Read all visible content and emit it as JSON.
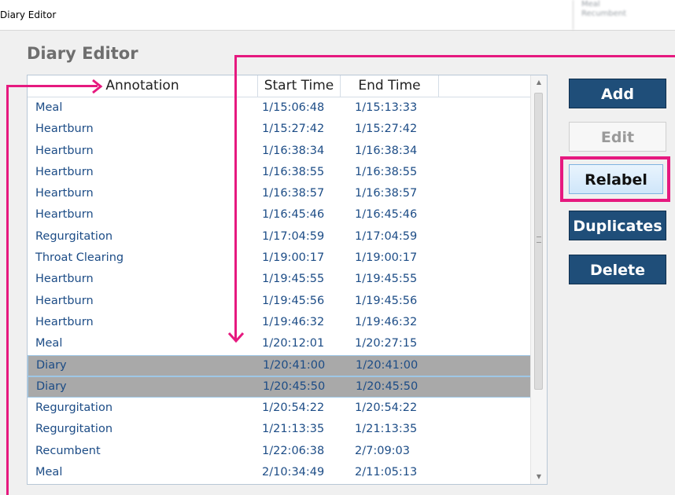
{
  "window": {
    "title": "Diary Editor",
    "blurred_text": [
      "Meal",
      "Recumbent"
    ]
  },
  "heading": "Diary Editor",
  "table": {
    "columns": [
      "Annotation",
      "Start Time",
      "End Time"
    ],
    "rows": [
      {
        "annotation": "Meal",
        "start": "1/15:06:48",
        "end": "1/15:13:33",
        "selected": false
      },
      {
        "annotation": "Heartburn",
        "start": "1/15:27:42",
        "end": "1/15:27:42",
        "selected": false
      },
      {
        "annotation": "Heartburn",
        "start": "1/16:38:34",
        "end": "1/16:38:34",
        "selected": false
      },
      {
        "annotation": "Heartburn",
        "start": "1/16:38:55",
        "end": "1/16:38:55",
        "selected": false
      },
      {
        "annotation": "Heartburn",
        "start": "1/16:38:57",
        "end": "1/16:38:57",
        "selected": false
      },
      {
        "annotation": "Heartburn",
        "start": "1/16:45:46",
        "end": "1/16:45:46",
        "selected": false
      },
      {
        "annotation": "Regurgitation",
        "start": "1/17:04:59",
        "end": "1/17:04:59",
        "selected": false
      },
      {
        "annotation": "Throat Clearing",
        "start": "1/19:00:17",
        "end": "1/19:00:17",
        "selected": false
      },
      {
        "annotation": "Heartburn",
        "start": "1/19:45:55",
        "end": "1/19:45:55",
        "selected": false
      },
      {
        "annotation": "Heartburn",
        "start": "1/19:45:56",
        "end": "1/19:45:56",
        "selected": false
      },
      {
        "annotation": "Heartburn",
        "start": "1/19:46:32",
        "end": "1/19:46:32",
        "selected": false
      },
      {
        "annotation": "Meal",
        "start": "1/20:12:01",
        "end": "1/20:27:15",
        "selected": false
      },
      {
        "annotation": "Diary",
        "start": "1/20:41:00",
        "end": "1/20:41:00",
        "selected": true
      },
      {
        "annotation": "Diary",
        "start": "1/20:45:50",
        "end": "1/20:45:50",
        "selected": true
      },
      {
        "annotation": "Regurgitation",
        "start": "1/20:54:22",
        "end": "1/20:54:22",
        "selected": false
      },
      {
        "annotation": "Regurgitation",
        "start": "1/21:13:35",
        "end": "1/21:13:35",
        "selected": false
      },
      {
        "annotation": "Recumbent",
        "start": "1/22:06:38",
        "end": "2/7:09:03",
        "selected": false
      },
      {
        "annotation": "Meal",
        "start": "2/10:34:49",
        "end": "2/11:05:13",
        "selected": false
      }
    ]
  },
  "buttons": {
    "add": {
      "label": "Add",
      "enabled": true
    },
    "edit": {
      "label": "Edit",
      "enabled": false
    },
    "relabel": {
      "label": "Relabel",
      "enabled": true,
      "highlighted": true
    },
    "duplicates": {
      "label": "Duplicates",
      "enabled": true
    },
    "delete": {
      "label": "Delete",
      "enabled": true
    }
  },
  "colors": {
    "annotation_highlight": "#e6197f",
    "button_primary": "#1f4e79",
    "row_text": "#1c4c86",
    "selected_row": "#a9a9a9"
  }
}
